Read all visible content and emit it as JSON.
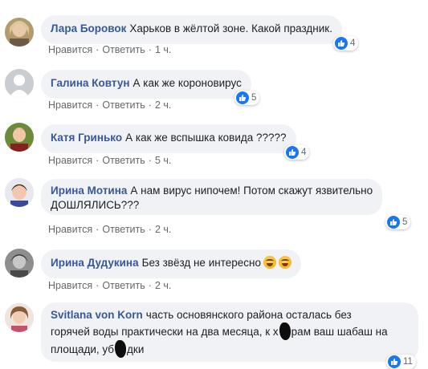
{
  "labels": {
    "like": "Нравится",
    "reply": "Ответить",
    "sep": "·"
  },
  "comments": [
    {
      "author": "Лара Боровок",
      "text": "Харьков в жёлтой зоне. Какой праздник.",
      "time": "1 ч.",
      "reactions": "4"
    },
    {
      "author": "Галина Ковтун",
      "text": "А как же короновирус",
      "time": "2 ч.",
      "reactions": "5"
    },
    {
      "author": "Катя Гринько",
      "text": "А как же вспышка ковида ?????",
      "time": "5 ч.",
      "reactions": "4"
    },
    {
      "author": "Ирина Мотина",
      "text_line1": "А нам вирус нипочем! Потом скажут язвительно",
      "text_line2": "ДОШЛЯЛИСЬ???",
      "time": "2 ч.",
      "reactions": "5"
    },
    {
      "author": "Ирина Дудукина",
      "text": "Без звёзд не интересно",
      "time": "2 ч."
    },
    {
      "author": "Svitlana von Korn",
      "text_line1": "часть основянского района осталась без",
      "text_line2a": "горячей воды практически на два месяца, к х",
      "text_line2b": "рам ваш шабаш на",
      "text_line3a": "площади, уб",
      "text_line3b": "дки",
      "reactions": "11"
    }
  ],
  "colors": {
    "author": "#385898",
    "bubble": "#f0f2f5",
    "meta": "#65676b",
    "like": "#1877f2"
  }
}
